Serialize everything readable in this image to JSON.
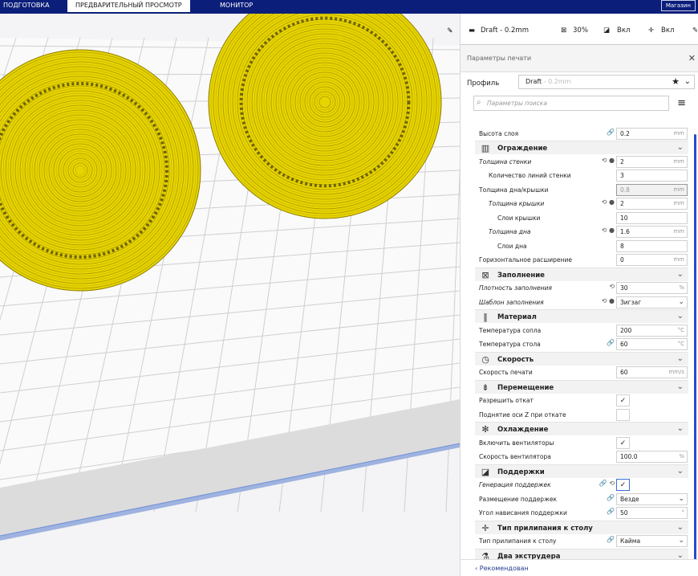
{
  "topbar": {
    "tabs": [
      {
        "label": "ПОДГОТОВКА"
      },
      {
        "label": "ПРЕДВАРИТЕЛЬНЫЙ ПРОСМОТР"
      },
      {
        "label": "МОНИТОР"
      }
    ],
    "store": "Магазин"
  },
  "strip": {
    "profile": "Draft - 0.2mm",
    "infill": "30%",
    "support": "Вкл",
    "adhesion": "Вкл"
  },
  "panel": {
    "title": "Параметры печати",
    "profile_label": "Профиль",
    "profile_value": "Draft",
    "profile_value_suffix": " - 0.2mm",
    "search_placeholder": "Параметры поиска",
    "footer": "Рекомендован",
    "rows": {
      "layer_height": {
        "label": "Высота слоя",
        "value": "0.2",
        "unit": "mm"
      },
      "wall_thickness": {
        "label": "Толщина стенки",
        "value": "2",
        "unit": "mm"
      },
      "wall_lines": {
        "label": "Количество линий стенки",
        "value": "3"
      },
      "tb_thickness": {
        "label": "Толщина дна/крышки",
        "value": "0.8",
        "unit": "mm"
      },
      "top_thickness": {
        "label": "Толщина крышки",
        "value": "2",
        "unit": "mm"
      },
      "top_layers": {
        "label": "Слои крышки",
        "value": "10"
      },
      "bottom_thickness": {
        "label": "Толщина дна",
        "value": "1.6",
        "unit": "mm"
      },
      "bottom_layers": {
        "label": "Слои дна",
        "value": "8"
      },
      "horiz_expansion": {
        "label": "Горизонтальное расширение",
        "value": "0",
        "unit": "mm"
      },
      "infill_density": {
        "label": "Плотность заполнения",
        "value": "30",
        "unit": "%"
      },
      "infill_pattern": {
        "label": "Шаблон заполнения",
        "value": "Зигзаг"
      },
      "nozzle_temp": {
        "label": "Температура сопла",
        "value": "200",
        "unit": "°C"
      },
      "bed_temp": {
        "label": "Температура стола",
        "value": "60",
        "unit": "°C"
      },
      "print_speed": {
        "label": "Скорость печати",
        "value": "60",
        "unit": "mm/s"
      },
      "retraction": {
        "label": "Разрешить откат",
        "checked": "✓"
      },
      "z_hop": {
        "label": "Поднятие оси Z при откате",
        "checked": ""
      },
      "fans": {
        "label": "Включить вентиляторы",
        "checked": "✓"
      },
      "fan_speed": {
        "label": "Скорость вентилятора",
        "value": "100.0",
        "unit": "%"
      },
      "support_gen": {
        "label": "Генерация поддержек",
        "checked": "✓"
      },
      "support_place": {
        "label": "Размещение поддержек",
        "value": "Везде"
      },
      "support_angle": {
        "label": "Угол нависания поддержки",
        "value": "50",
        "unit": "°"
      },
      "adhesion_type": {
        "label": "Тип прилипания к столу",
        "value": "Кайма"
      }
    },
    "categories": {
      "shell": "Ограждение",
      "infill": "Заполнение",
      "material": "Материал",
      "speed": "Скорость",
      "travel": "Перемещение",
      "cooling": "Охлаждение",
      "support": "Поддержки",
      "adhesion": "Тип прилипания к столу",
      "dual": "Два экструдера"
    }
  },
  "colors": {
    "topbar": "#0b1e7a",
    "model": "#e8d400",
    "accent": "#2a4ac9"
  }
}
